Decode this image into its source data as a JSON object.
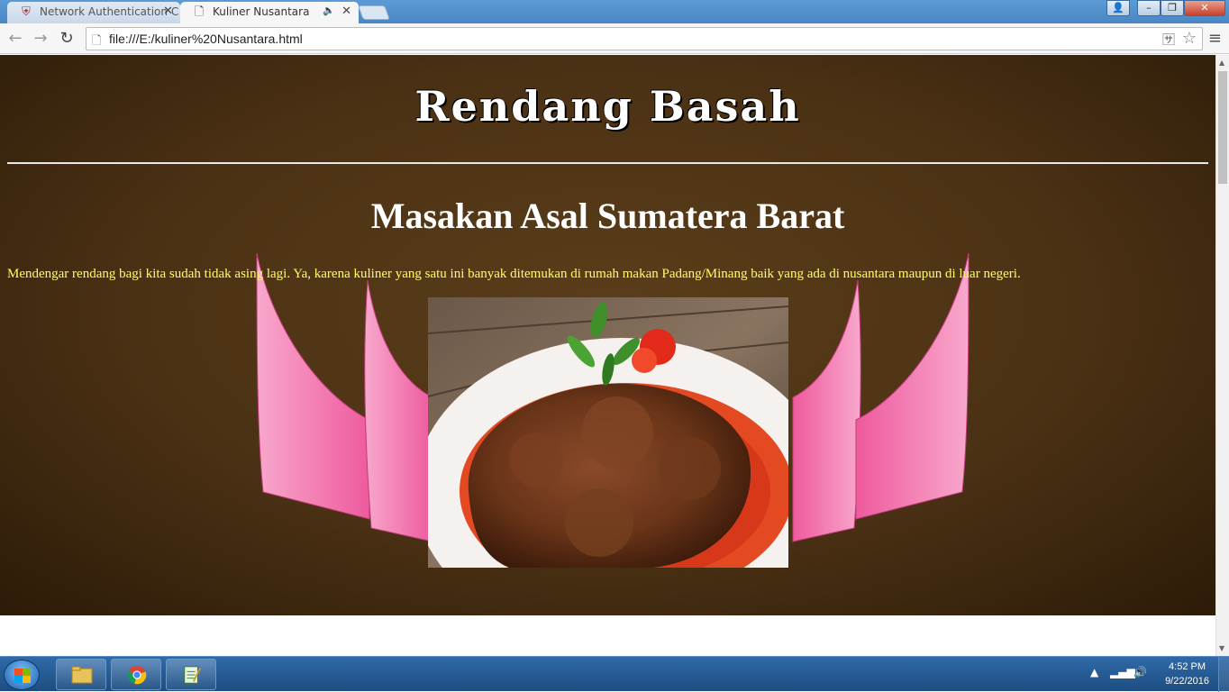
{
  "browser": {
    "tabs": [
      {
        "label": "Network Authentication C",
        "icon": "shield-icon",
        "active": false
      },
      {
        "label": "Kuliner Nusantara",
        "icon": "page-icon",
        "active": true
      }
    ],
    "window_buttons": [
      "user-icon",
      "minimize-icon",
      "restore-icon",
      "close-icon"
    ],
    "url": "file:///E:/kuliner%20Nusantara.html"
  },
  "page": {
    "title": "Rendang Basah",
    "subtitle": "Masakan Asal Sumatera Barat",
    "intro": "Mendengar rendang bagi kita sudah tidak asing lagi. Ya, karena kuliner yang satu ini banyak ditemukan di rumah makan Padang/Minang baik yang ada di nusantara maupun di luar negeri.",
    "colors": {
      "background": "#4b3114",
      "intro_text": "#ffff66",
      "roof": "#f06aa8"
    }
  },
  "taskbar": {
    "apps": [
      "folder-icon",
      "chrome-icon",
      "notepad-icon"
    ],
    "clock": {
      "time": "4:52 PM",
      "date": "9/22/2016"
    }
  }
}
